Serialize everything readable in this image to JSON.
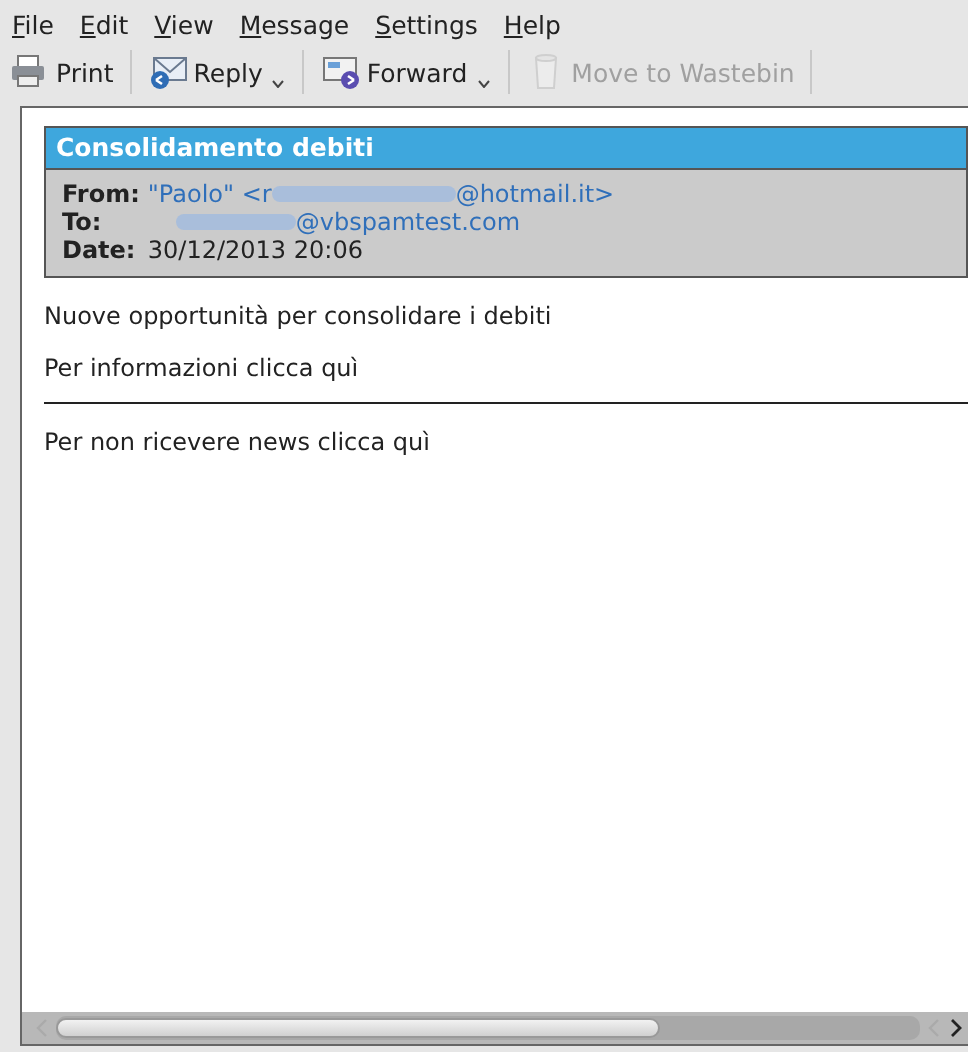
{
  "menu_bar": [
    "File",
    "Edit",
    "View",
    "Message",
    "Settings",
    "Help"
  ],
  "toolbar": [
    {
      "kind": "print",
      "label": "Print",
      "disabled": false,
      "dropdown": false
    },
    {
      "kind": "reply",
      "label": "Reply",
      "disabled": false,
      "dropdown": true
    },
    {
      "kind": "forward",
      "label": "Forward",
      "disabled": false,
      "dropdown": true
    },
    {
      "kind": "trash",
      "label": "Move to Wastebin",
      "disabled": true,
      "dropdown": false
    }
  ],
  "message": {
    "subject": "Consolidamento debiti",
    "headers": [
      {
        "label": "From:",
        "before": "\"Paolo\" <r",
        "after": "@hotmail.it>",
        "redacted": true,
        "link": true
      },
      {
        "label": "To:",
        "after": "@vbspamtest.com",
        "redacted": true,
        "link": true
      },
      {
        "label": "Date:",
        "after": "30/12/2013 20:06",
        "redacted": false,
        "link": false
      }
    ],
    "body": [
      {
        "kind": "text",
        "text": "Nuove opportunità per consolidare i debiti"
      },
      {
        "kind": "text",
        "text": "Per informazioni clicca quì"
      },
      {
        "kind": "rule"
      },
      {
        "kind": "text",
        "text": "Per non ricevere news clicca quì"
      }
    ]
  }
}
